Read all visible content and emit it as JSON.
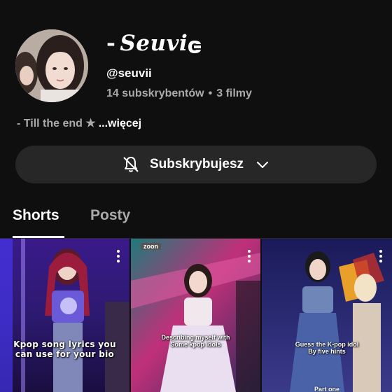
{
  "channel": {
    "name": "Seuvi",
    "name_prefix": "-",
    "handle": "@seuvii",
    "subscribers": "14 subskrybentów",
    "separator": "•",
    "videos": "3 filmy",
    "bio": "- Till the end ★",
    "bio_more": "...więcej",
    "brand_icon": "b-logo-icon"
  },
  "subscribe": {
    "label": "Subskrybujesz",
    "bell_icon": "bell-off-icon",
    "chevron_icon": "chevron-down-icon"
  },
  "tabs": [
    {
      "label": "Shorts",
      "active": true
    },
    {
      "label": "Posty",
      "active": false
    }
  ],
  "shorts": [
    {
      "caption_line1": "Kpop song lyrics you",
      "caption_line2": "can use for your bio"
    },
    {
      "caption_line1": "Describing myself with",
      "caption_line2": "Some kpop idols",
      "badge": "zoon"
    },
    {
      "caption_line1": "Guess the K-pop idol",
      "caption_line2": "By five hints",
      "footer": "Part one"
    }
  ],
  "colors": {
    "background": "#0f0f0f",
    "button": "#272727",
    "secondary_text": "#aaaaaa"
  }
}
